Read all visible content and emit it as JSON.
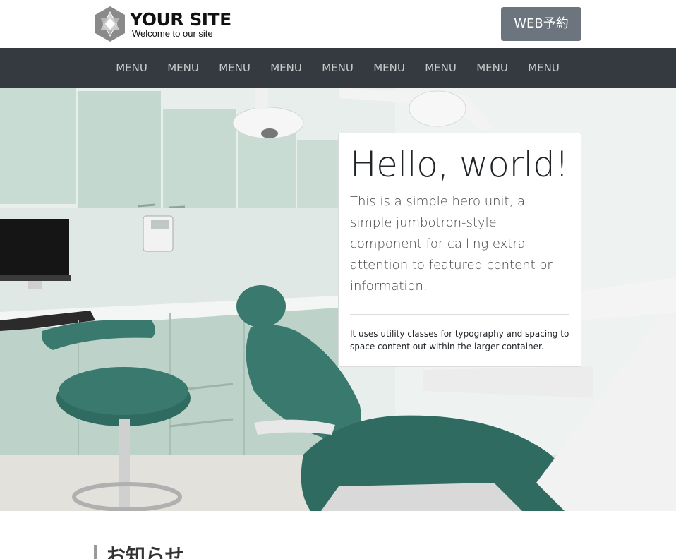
{
  "header": {
    "logo_title": "YOUR SITE",
    "logo_subtitle": "Welcome to our site",
    "web_button": "WEB予約"
  },
  "nav": {
    "items": [
      "MENU",
      "MENU",
      "MENU",
      "MENU",
      "MENU",
      "MENU",
      "MENU",
      "MENU",
      "MENU"
    ]
  },
  "hero": {
    "title": "Hello, world!",
    "lead": "This is a simple hero unit, a simple jumbotron-style component for calling extra attention to featured content or information.",
    "small": "It uses utility classes for typography and spacing to space content out within the larger container."
  },
  "news": {
    "title": "お知らせ"
  },
  "colors": {
    "nav_bg": "#343a40",
    "button_bg": "#6c757d"
  }
}
